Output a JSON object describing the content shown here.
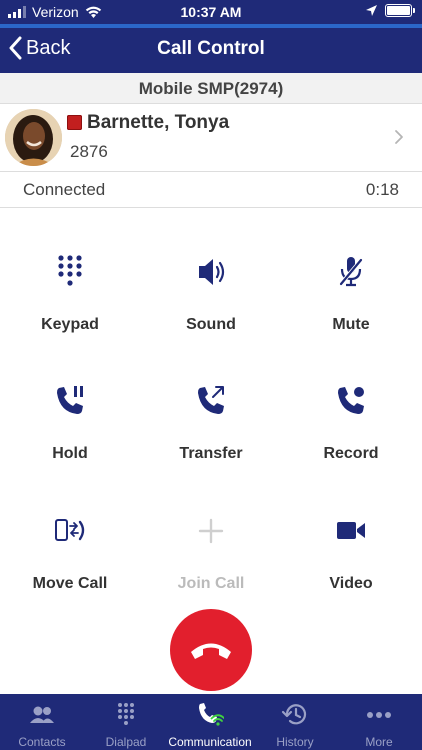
{
  "status_bar": {
    "carrier": "Verizon",
    "time": "10:37 AM",
    "battery_level": 1.0
  },
  "nav": {
    "back_label": "Back",
    "title": "Call Control"
  },
  "line_label": "Mobile SMP(2974)",
  "contact": {
    "name": "Barnette, Tonya",
    "extension": "2876",
    "presence_color": "#c21f1f"
  },
  "call": {
    "status": "Connected",
    "duration": "0:18"
  },
  "controls": {
    "keypad": "Keypad",
    "sound": "Sound",
    "mute": "Mute",
    "hold": "Hold",
    "transfer": "Transfer",
    "record": "Record",
    "move_call": "Move Call",
    "join_call": "Join Call",
    "video": "Video"
  },
  "tabs": [
    {
      "label": "Contacts",
      "icon": "contacts-icon"
    },
    {
      "label": "Dialpad",
      "icon": "dialpad-icon"
    },
    {
      "label": "Communication",
      "icon": "communication-icon",
      "active": true
    },
    {
      "label": "History",
      "icon": "history-icon"
    },
    {
      "label": "More",
      "icon": "more-icon"
    }
  ],
  "colors": {
    "header": "#1f2a78",
    "accent": "#2b67c9",
    "icon": "#1f2a78",
    "end_call": "#e21f2d",
    "presence_busy": "#c21f1f"
  }
}
